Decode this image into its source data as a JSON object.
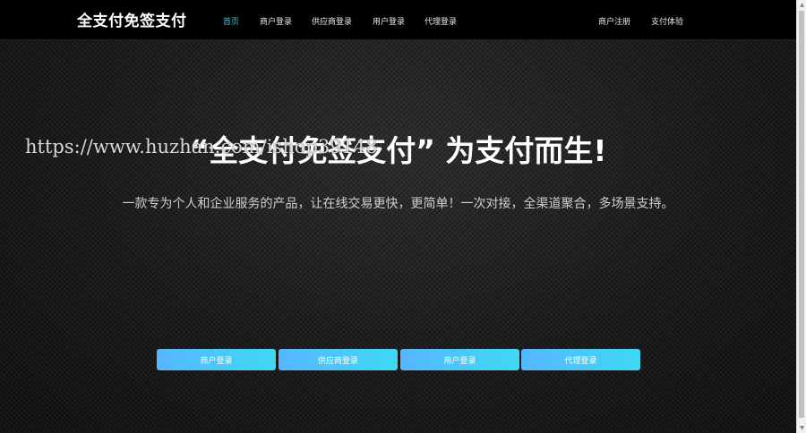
{
  "header": {
    "brand": "全支付免签支付",
    "nav_left": [
      {
        "label": "首页",
        "active": true
      },
      {
        "label": "商户登录",
        "active": false
      },
      {
        "label": "供应商登录",
        "active": false
      },
      {
        "label": "用户登录",
        "active": false
      },
      {
        "label": "代理登录",
        "active": false
      }
    ],
    "nav_right": [
      {
        "label": "商户注册"
      },
      {
        "label": "支付体验"
      }
    ]
  },
  "hero": {
    "title": "“全支付免签支付” 为支付而生!",
    "subtitle": "一款专为个人和企业服务的产品，让在线交易更快，更简单！一次对接，全渠道聚合，多场景支持。",
    "watermark": "https://www.huzhan.com/ishop39148"
  },
  "buttons": [
    {
      "label": "商户登录"
    },
    {
      "label": "供应商登录"
    },
    {
      "label": "用户登录"
    },
    {
      "label": "代理登录"
    }
  ],
  "colors": {
    "accent": "#3cc6d8",
    "button_start": "#57b6ff",
    "button_end": "#3ed9f3",
    "header_bg": "#000000"
  },
  "icons": {
    "scroll_up": "up-arrow-icon",
    "scroll_down": "down-arrow-icon"
  }
}
